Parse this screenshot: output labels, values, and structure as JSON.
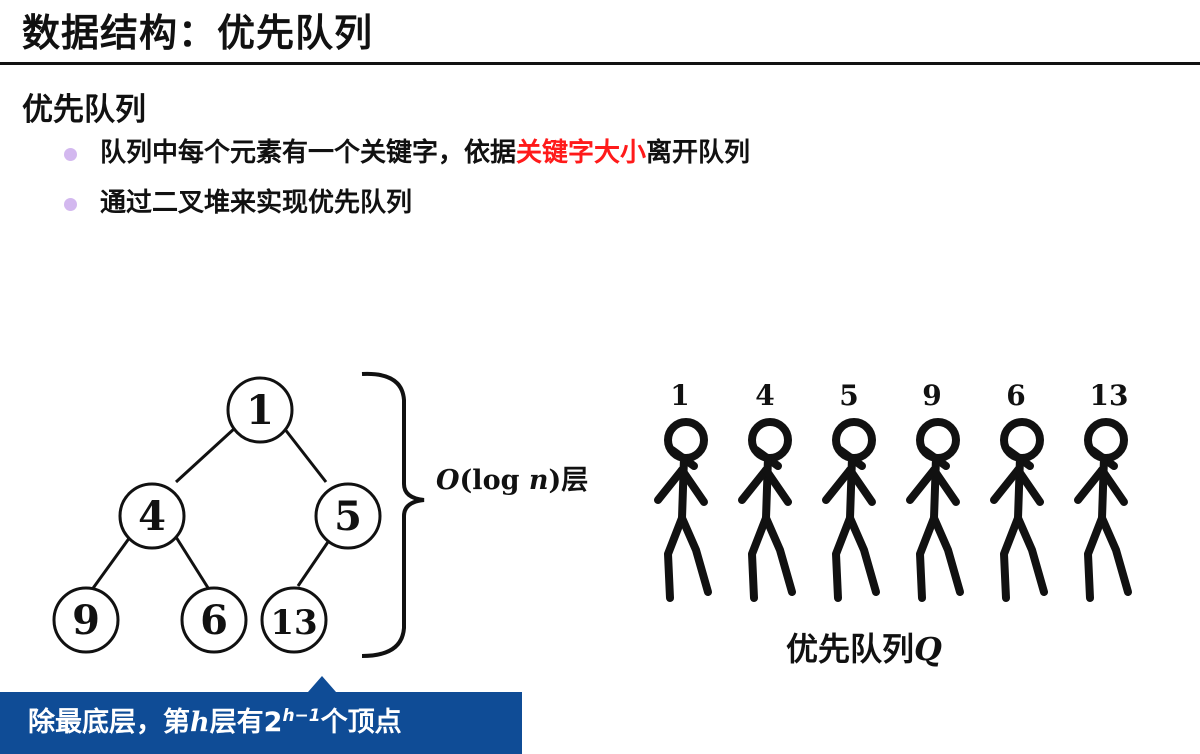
{
  "header": {
    "title": "数据结构：优先队列"
  },
  "section": {
    "heading": "优先队列",
    "bullets": [
      {
        "before": "队列中每个元素有一个关键字，依据",
        "highlight": "关键字大小",
        "after": "离开队列"
      },
      {
        "before": "通过二叉堆来实现优先队列",
        "highlight": "",
        "after": ""
      }
    ]
  },
  "heap": {
    "nodes": [
      "1",
      "4",
      "5",
      "9",
      "6",
      "13"
    ],
    "brace_label": {
      "prefix": "O",
      "middle": "(log ",
      "var": "n",
      "suffix": ")层"
    }
  },
  "queue": {
    "values": [
      "1",
      "4",
      "5",
      "9",
      "6",
      "13"
    ],
    "label_text": "优先队列",
    "label_var": "Q"
  },
  "callout": {
    "text_before": "除最底层，第",
    "var": "h",
    "text_middle": "层有2",
    "superscript": "h−1",
    "text_after": "个顶点"
  },
  "colors": {
    "highlight": "#ff1a1a",
    "bullet": "#d3b8ef",
    "callout": "#0f4c96"
  }
}
